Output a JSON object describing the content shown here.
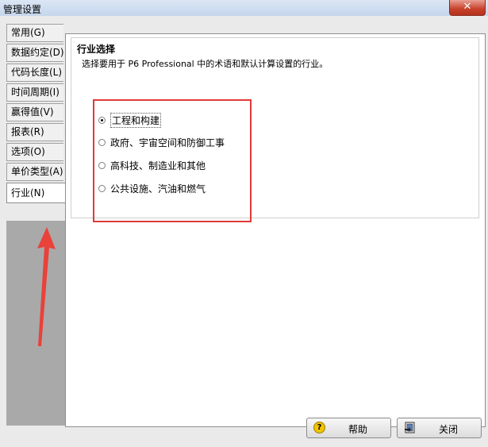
{
  "window": {
    "title": "管理设置",
    "close_glyph": "✕"
  },
  "tabs": [
    {
      "label": "常用(G)",
      "selected": false
    },
    {
      "label": "数据约定(D)",
      "selected": false
    },
    {
      "label": "代码长度(L)",
      "selected": false
    },
    {
      "label": "时间周期(I)",
      "selected": false
    },
    {
      "label": "赢得值(V)",
      "selected": false
    },
    {
      "label": "报表(R)",
      "selected": false
    },
    {
      "label": "选项(O)",
      "selected": false
    },
    {
      "label": "单价类型(A)",
      "selected": false
    },
    {
      "label": "行业(N)",
      "selected": true
    }
  ],
  "section": {
    "title": "行业选择",
    "description": "选择要用于 P6 Professional 中的术语和默认计算设置的行业。"
  },
  "industry_options": [
    {
      "label": "工程和构建",
      "checked": true
    },
    {
      "label": "政府、宇宙空间和防御工事",
      "checked": false
    },
    {
      "label": "高科技、制造业和其他",
      "checked": false
    },
    {
      "label": "公共设施、汽油和燃气",
      "checked": false
    }
  ],
  "buttons": {
    "help_label": "帮助",
    "help_icon_glyph": "?",
    "close_label": "关闭"
  },
  "colors": {
    "highlight_box": "#e03a3a",
    "arrow": "#e8423a"
  }
}
